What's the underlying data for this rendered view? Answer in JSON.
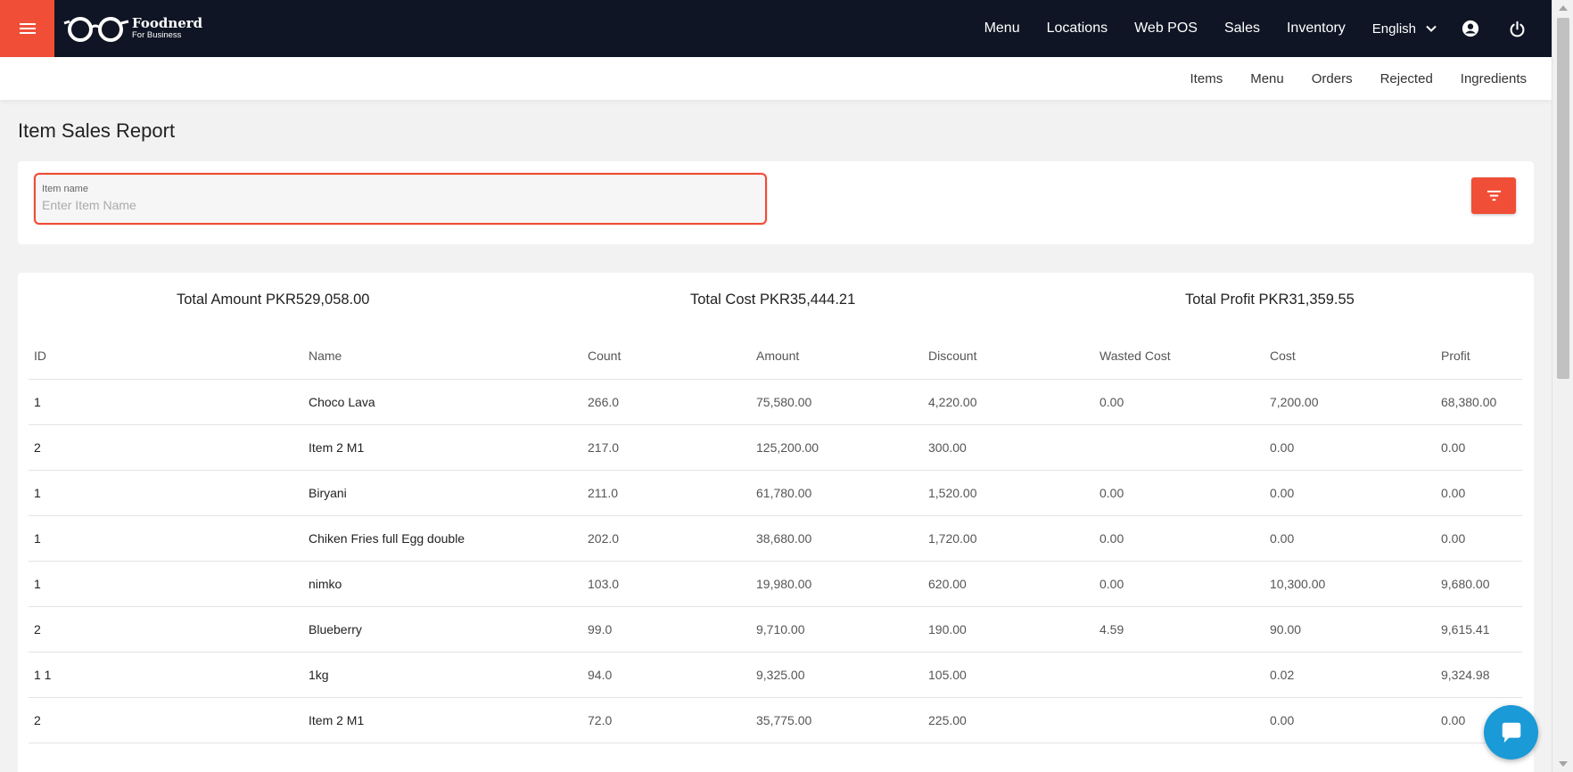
{
  "app": {
    "brand": "Foodnerd",
    "brand_sub": "For Business"
  },
  "nav": {
    "items": [
      "Menu",
      "Locations",
      "Web POS",
      "Sales",
      "Inventory"
    ],
    "language": "English"
  },
  "subnav": {
    "items": [
      "Items",
      "Menu",
      "Orders",
      "Rejected",
      "Ingredients"
    ]
  },
  "page": {
    "title": "Item Sales Report"
  },
  "filter": {
    "label": "Item name",
    "placeholder": "Enter Item Name",
    "value": ""
  },
  "totals": {
    "amount": "Total Amount PKR529,058.00",
    "cost": "Total Cost PKR35,444.21",
    "profit": "Total Profit PKR31,359.55"
  },
  "table": {
    "columns": [
      "ID",
      "Name",
      "Count",
      "Amount",
      "Discount",
      "Wasted Cost",
      "Cost",
      "Profit"
    ],
    "rows": [
      [
        "1",
        "Choco Lava",
        "266.0",
        "75,580.00",
        "4,220.00",
        "0.00",
        "7,200.00",
        "68,380.00"
      ],
      [
        "2",
        "Item 2 M1",
        "217.0",
        "125,200.00",
        "300.00",
        "",
        "0.00",
        "0.00"
      ],
      [
        "1",
        "Biryani",
        "211.0",
        "61,780.00",
        "1,520.00",
        "0.00",
        "0.00",
        "0.00"
      ],
      [
        "1",
        "Chiken Fries full Egg double",
        "202.0",
        "38,680.00",
        "1,720.00",
        "0.00",
        "0.00",
        "0.00"
      ],
      [
        "1",
        "nimko",
        "103.0",
        "19,980.00",
        "620.00",
        "0.00",
        "10,300.00",
        "9,680.00"
      ],
      [
        "2",
        "Blueberry",
        "99.0",
        "9,710.00",
        "190.00",
        "4.59",
        "90.00",
        "9,615.41"
      ],
      [
        "1 1",
        "1kg",
        "94.0",
        "9,325.00",
        "105.00",
        "",
        "0.02",
        "9,324.98"
      ],
      [
        "2",
        "Item 2 M1",
        "72.0",
        "35,775.00",
        "225.00",
        "",
        "0.00",
        "0.00"
      ]
    ]
  },
  "colors": {
    "accent": "#f04e37",
    "navbar": "#0f1524",
    "chat": "#1a9ad6"
  }
}
